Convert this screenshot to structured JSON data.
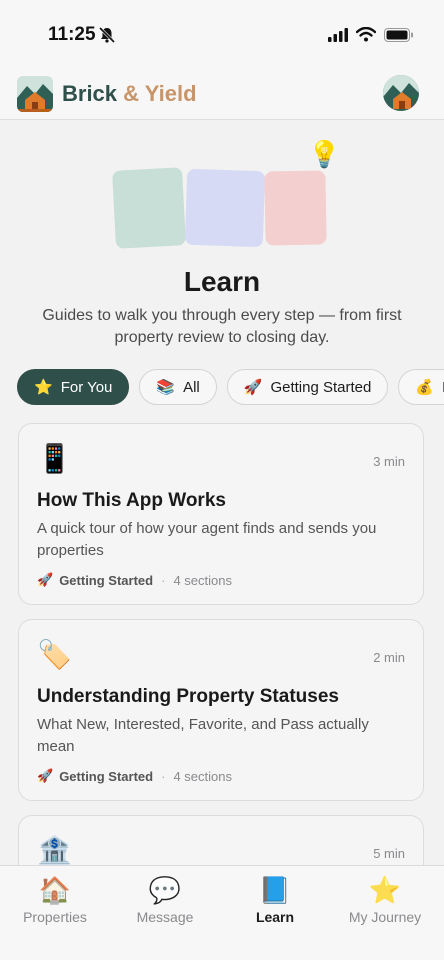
{
  "status_bar": {
    "time": "11:25"
  },
  "header": {
    "brand_part1": "Brick",
    "brand_part2": "& Yield"
  },
  "hero": {
    "bulb_emoji": "💡"
  },
  "page": {
    "title": "Learn",
    "subtitle": "Guides to walk you through every step — from first property review to closing day."
  },
  "chips": [
    {
      "emoji": "⭐",
      "label": "For You",
      "active": true
    },
    {
      "emoji": "📚",
      "label": "All",
      "active": false
    },
    {
      "emoji": "🚀",
      "label": "Getting Started",
      "active": false
    },
    {
      "emoji": "💰",
      "label": "I",
      "active": false
    }
  ],
  "cards": [
    {
      "emoji": "📱",
      "time": "3 min",
      "title": "How This App Works",
      "description": "A quick tour of how your agent finds and sends you properties",
      "category_emoji": "🚀",
      "category": "Getting Started",
      "sections": "4 sections"
    },
    {
      "emoji": "🏷️",
      "time": "2 min",
      "title": "Understanding Property Statuses",
      "description": "What New, Interested, Favorite, and Pass actually mean",
      "category_emoji": "🚀",
      "category": "Getting Started",
      "sections": "4 sections"
    },
    {
      "emoji": "🏦",
      "time": "5 min"
    }
  ],
  "tabs": [
    {
      "icon": "🏠",
      "label": "Properties",
      "active": false
    },
    {
      "icon": "💬",
      "label": "Message",
      "active": false
    },
    {
      "icon": "📘",
      "label": "Learn",
      "active": true
    },
    {
      "icon": "⭐",
      "label": "My Journey",
      "active": false
    }
  ],
  "colors": {
    "brand_dark": "#2f4f4a",
    "brand_accent": "#c8956a"
  }
}
